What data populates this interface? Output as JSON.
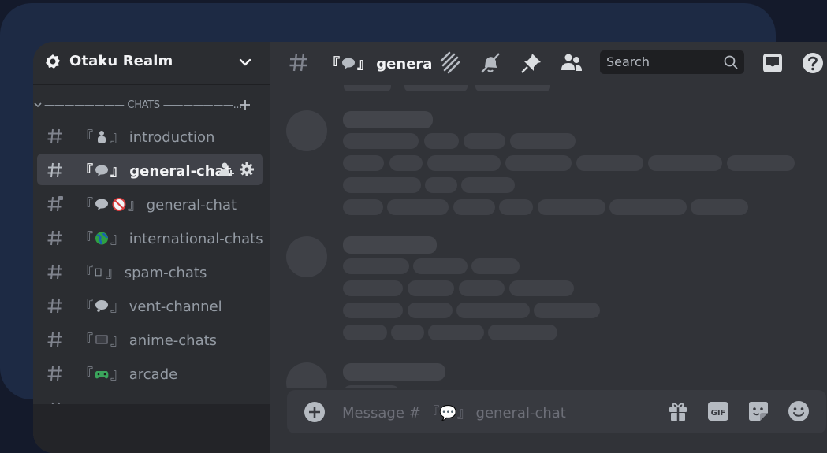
{
  "server": {
    "name": "Otaku Realm"
  },
  "category": {
    "label": "———————— CHATS ———————..."
  },
  "channels": [
    {
      "name": "introduction",
      "emoji": "person-emoji",
      "active": false
    },
    {
      "name": "general-chat",
      "emoji": "speech-bubble-emoji",
      "active": true
    },
    {
      "name": "general-chat",
      "emoji": "speech-bubble-no-under-18-emoji",
      "active": false,
      "locked": true
    },
    {
      "name": "international-chats",
      "emoji": "globe-emoji",
      "active": false
    },
    {
      "name": "spam-chats",
      "emoji": "box-glyph",
      "active": false
    },
    {
      "name": "vent-channel",
      "emoji": "thought-bubble-emoji",
      "active": false
    },
    {
      "name": "anime-chats",
      "emoji": "tv-emoji",
      "active": false
    },
    {
      "name": "arcade",
      "emoji": "game-controller-emoji",
      "active": false
    }
  ],
  "header": {
    "channel_name": "general-chat",
    "icons": [
      "threads-icon",
      "mute-bell-icon",
      "pin-icon",
      "members-icon",
      "inbox-icon",
      "help-icon"
    ]
  },
  "search": {
    "placeholder": "Search"
  },
  "composer": {
    "placeholder": "Message # 『💬』 general-chat",
    "icons": [
      "add-attachment-icon",
      "gift-icon",
      "gif-icon",
      "sticker-icon",
      "emoji-icon"
    ]
  },
  "bracket": {
    "open": "『",
    "close": "』"
  },
  "colors": {
    "background": "#141a2b",
    "panel": "#1d2a44",
    "sidebar": "#2b2d31",
    "main": "#313338",
    "active": "#404249",
    "text": "#f2f3f5",
    "muted": "#949ba4"
  }
}
